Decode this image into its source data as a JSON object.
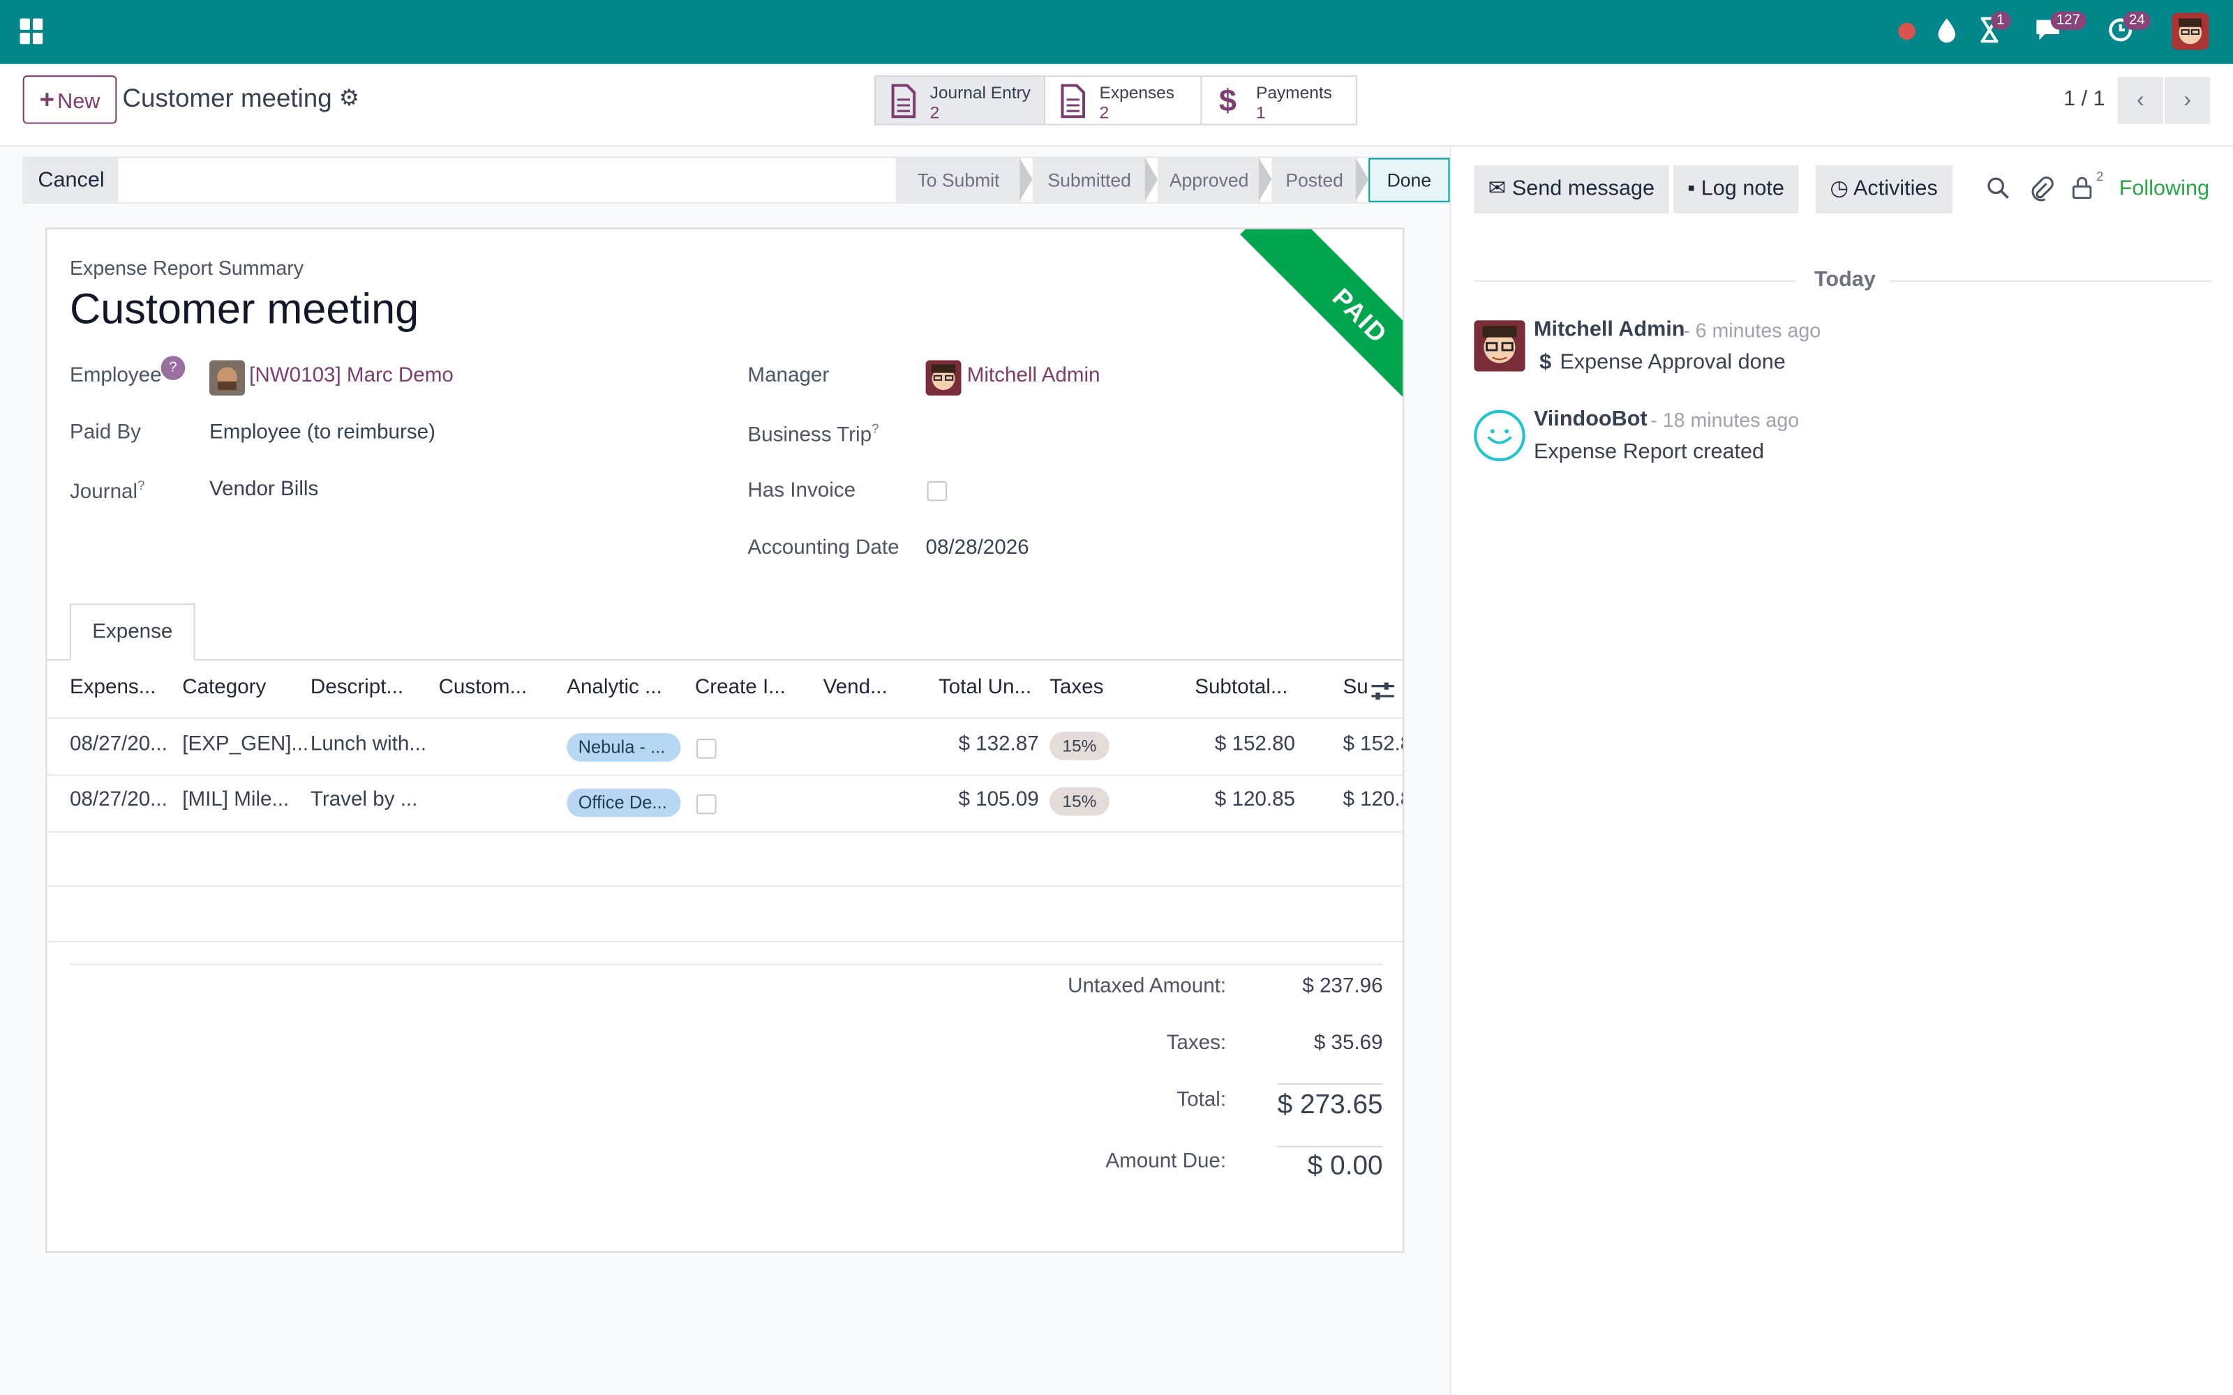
{
  "topbar": {
    "badges": {
      "activities": "1",
      "messages": "127",
      "updates": "24"
    }
  },
  "control_panel": {
    "new_label": "New",
    "record_title": "Customer meeting",
    "smart_buttons": [
      {
        "label": "Journal Entry",
        "count": "2"
      },
      {
        "label": "Expenses",
        "count": "2"
      },
      {
        "label": "Payments",
        "count": "1"
      }
    ],
    "pager": "1 / 1"
  },
  "statusbar": {
    "cancel_label": "Cancel",
    "stages": [
      "To Submit",
      "Submitted",
      "Approved",
      "Posted",
      "Done"
    ],
    "active_stage": "Done"
  },
  "sheet": {
    "ribbon": "PAID",
    "subtitle": "Expense Report Summary",
    "title": "Customer meeting",
    "fields": {
      "employee_label": "Employee",
      "employee_help": "?",
      "employee_value": "[NW0103] Marc Demo",
      "paid_by_label": "Paid By",
      "paid_by_value": "Employee (to reimburse)",
      "journal_label": "Journal",
      "journal_value": "Vendor Bills",
      "manager_label": "Manager",
      "manager_value": "Mitchell Admin",
      "business_trip_label": "Business Trip",
      "has_invoice_label": "Has Invoice",
      "accounting_date_label": "Accounting Date",
      "accounting_date_value": "08/28/2026",
      "help_mark": "?"
    },
    "tab_label": "Expense",
    "table": {
      "headers": [
        "Expens...",
        "Category",
        "Descript...",
        "Custom...",
        "Analytic ...",
        "Create I...",
        "Vend...",
        "Total Un...",
        "Taxes",
        "Subtotal...",
        "Su"
      ],
      "rows": [
        {
          "date": "08/27/20...",
          "category": "[EXP_GEN]...",
          "description": "Lunch with...",
          "analytic": "Nebula - ...",
          "total": "$ 132.87",
          "tax": "15%",
          "subtotal": "$ 152.80",
          "sum": "$ 152.8"
        },
        {
          "date": "08/27/20...",
          "category": "[MIL] Mile...",
          "description": "Travel by ...",
          "analytic": "Office De...",
          "total": "$ 105.09",
          "tax": "15%",
          "subtotal": "$ 120.85",
          "sum": "$ 120.8"
        }
      ]
    },
    "totals": {
      "untaxed_label": "Untaxed Amount:",
      "untaxed_value": "$ 237.96",
      "taxes_label": "Taxes:",
      "taxes_value": "$ 35.69",
      "total_label": "Total:",
      "total_value": "$ 273.65",
      "due_label": "Amount Due:",
      "due_value": "$ 0.00"
    }
  },
  "chatter": {
    "send_message": "Send message",
    "log_note": "Log note",
    "activities": "Activities",
    "followers_count": "2",
    "following": "Following",
    "today": "Today",
    "messages": [
      {
        "author": "Mitchell Admin",
        "time": "- 6 minutes ago",
        "body": "Expense Approval done"
      },
      {
        "author": "ViindooBot",
        "time": "- 18 minutes ago",
        "body": "Expense Report created"
      }
    ]
  },
  "colors": {
    "topbar": "#00868b",
    "brand": "#7c3d6f",
    "paid_ribbon": "#00a550",
    "following": "#28a745"
  }
}
